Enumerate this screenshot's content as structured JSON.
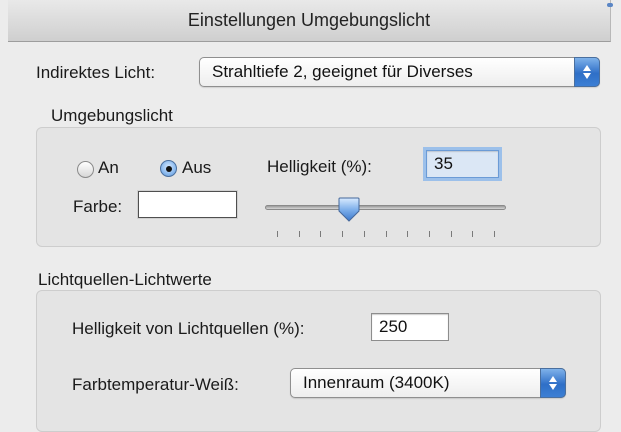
{
  "window": {
    "title": "Einstellungen Umgebungslicht"
  },
  "indirect_light": {
    "label": "Indirektes Licht:",
    "selected": "Strahltiefe 2, geeignet für Diverses",
    "stepper_icon": "up-down-arrows"
  },
  "ambient": {
    "heading": "Umgebungslicht",
    "radio_on_label": "An",
    "radio_off_label": "Aus",
    "selected": "Aus",
    "brightness_label": "Helligkeit (%):",
    "brightness_value": "35",
    "color_label": "Farbe:",
    "color_value": "#ffffff",
    "slider_percent": 35,
    "slider_ticks": 11
  },
  "light_sources": {
    "heading": "Lichtquellen-Lichtwerte",
    "brightness_label": "Helligkeit von Lichtquellen (%):",
    "brightness_value": "250",
    "temp_label": "Farbtemperatur-Weiß:",
    "temp_selected": "Innenraum (3400K)"
  },
  "colors": {
    "accent": "#3c7fd4",
    "focus_ring": "#9cc0ea",
    "background": "#ececec"
  }
}
